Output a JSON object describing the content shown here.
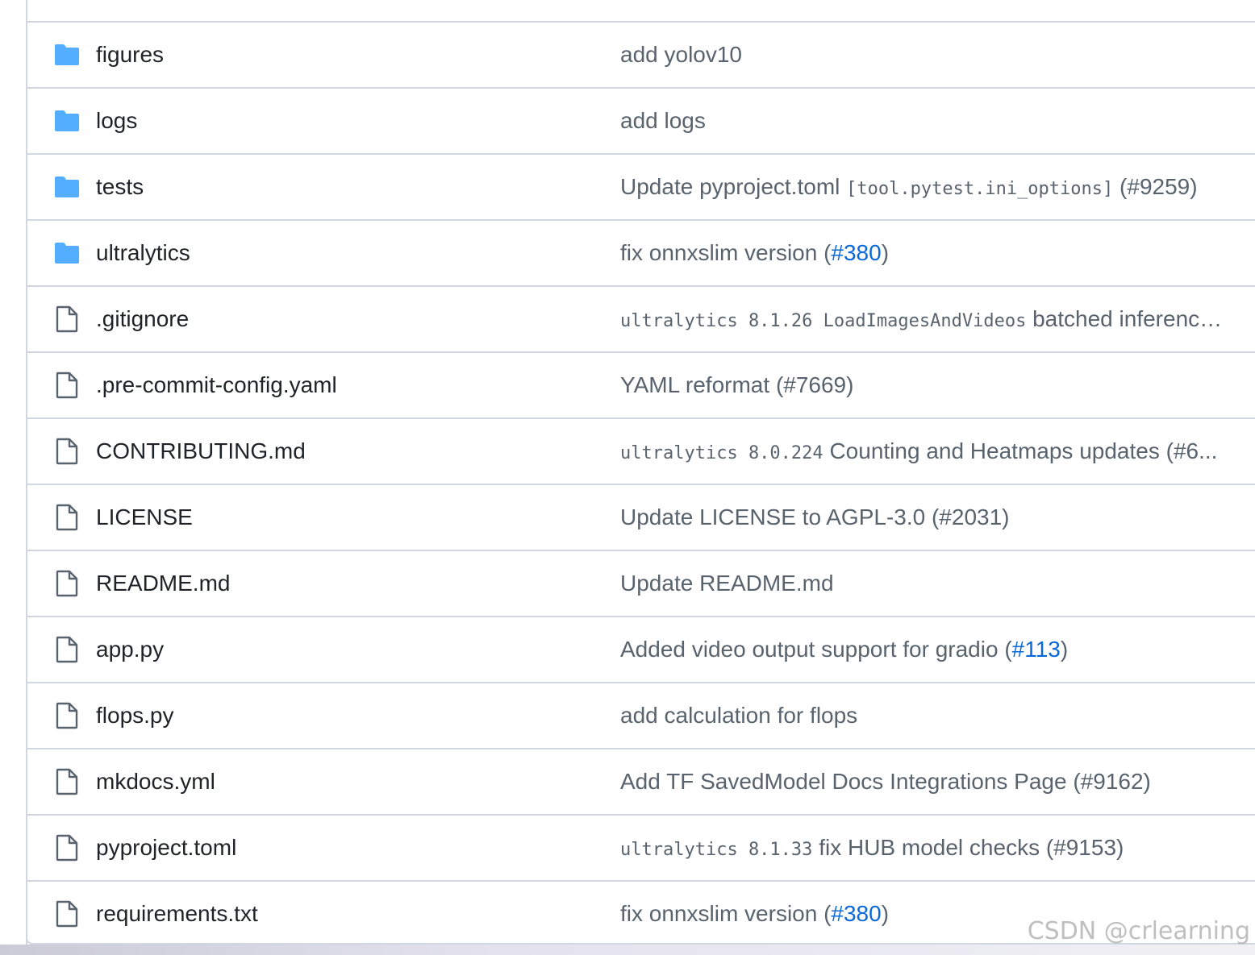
{
  "colors": {
    "folder_icon": "#54aeff",
    "file_icon": "#59636e",
    "link": "#0969da",
    "border": "#d0d7de"
  },
  "rows": [
    {
      "type": "folder",
      "icon": "folder-icon",
      "name": "figures",
      "message": [
        {
          "text": "add yolov10"
        }
      ]
    },
    {
      "type": "folder",
      "icon": "folder-icon",
      "name": "logs",
      "message": [
        {
          "text": "add logs"
        }
      ]
    },
    {
      "type": "folder",
      "icon": "folder-icon",
      "name": "tests",
      "message": [
        {
          "text": "Update pyproject.toml "
        },
        {
          "text": "[tool.pytest.ini_options]",
          "style": "mono"
        },
        {
          "text": " (#9259)"
        }
      ]
    },
    {
      "type": "folder",
      "icon": "folder-icon",
      "name": "ultralytics",
      "message": [
        {
          "text": "fix onnxslim version ("
        },
        {
          "text": "#380",
          "style": "link"
        },
        {
          "text": ")"
        }
      ]
    },
    {
      "type": "file",
      "icon": "file-icon",
      "name": ".gitignore",
      "message": [
        {
          "text": "ultralytics 8.1.26 LoadImagesAndVideos",
          "style": "mono"
        },
        {
          "text": " batched inference..."
        }
      ]
    },
    {
      "type": "file",
      "icon": "file-icon",
      "name": ".pre-commit-config.yaml",
      "message": [
        {
          "text": "YAML reformat (#7669)"
        }
      ]
    },
    {
      "type": "file",
      "icon": "file-icon",
      "name": "CONTRIBUTING.md",
      "message": [
        {
          "text": "ultralytics 8.0.224",
          "style": "mono"
        },
        {
          "text": " Counting and Heatmaps updates (#6..."
        }
      ]
    },
    {
      "type": "file",
      "icon": "file-icon",
      "name": "LICENSE",
      "message": [
        {
          "text": "Update LICENSE to AGPL-3.0 (#2031)"
        }
      ]
    },
    {
      "type": "file",
      "icon": "file-icon",
      "name": "README.md",
      "message": [
        {
          "text": "Update README.md"
        }
      ]
    },
    {
      "type": "file",
      "icon": "file-icon",
      "name": "app.py",
      "message": [
        {
          "text": "Added video output support for gradio ("
        },
        {
          "text": "#113",
          "style": "link"
        },
        {
          "text": ")"
        }
      ]
    },
    {
      "type": "file",
      "icon": "file-icon",
      "name": "flops.py",
      "message": [
        {
          "text": "add calculation for flops"
        }
      ]
    },
    {
      "type": "file",
      "icon": "file-icon",
      "name": "mkdocs.yml",
      "message": [
        {
          "text": "Add TF SavedModel Docs Integrations Page (#9162)"
        }
      ]
    },
    {
      "type": "file",
      "icon": "file-icon",
      "name": "pyproject.toml",
      "message": [
        {
          "text": "ultralytics 8.1.33",
          "style": "mono"
        },
        {
          "text": " fix HUB model checks (#9153)"
        }
      ]
    },
    {
      "type": "file",
      "icon": "file-icon",
      "name": "requirements.txt",
      "message": [
        {
          "text": "fix onnxslim version ("
        },
        {
          "text": "#380",
          "style": "link"
        },
        {
          "text": ")"
        }
      ]
    }
  ],
  "watermark": "CSDN @crlearning"
}
